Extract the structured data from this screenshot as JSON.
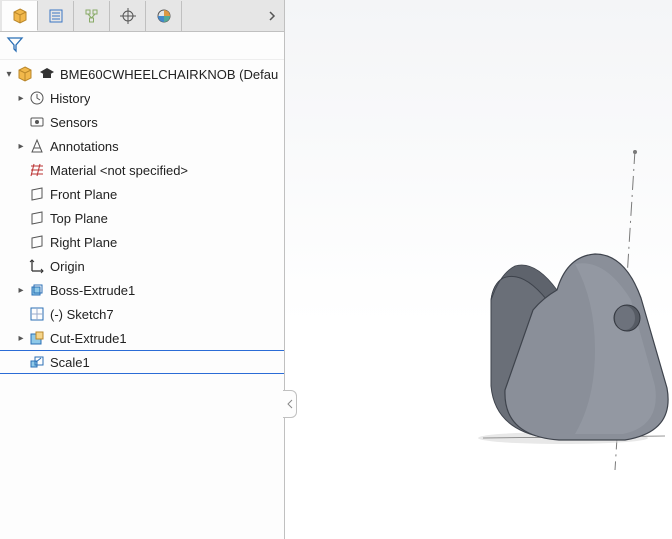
{
  "tabs": {
    "feature_tree": "Feature Manager",
    "property": "Property Manager",
    "config": "Configuration Manager",
    "dimxpert": "DimXpert",
    "display": "Display Manager"
  },
  "filter": {
    "tooltip": "Filter"
  },
  "root": {
    "label": "BME60CWHEELCHAIRKNOB  (Defau"
  },
  "nodes": {
    "history": "History",
    "sensors": "Sensors",
    "annotations": "Annotations",
    "material": "Material <not specified>",
    "front_plane": "Front Plane",
    "top_plane": "Top Plane",
    "right_plane": "Right Plane",
    "origin": "Origin",
    "boss_extrude1": "Boss-Extrude1",
    "sketch7": "(-) Sketch7",
    "cut_extrude1": "Cut-Extrude1",
    "scale1": "Scale1"
  }
}
